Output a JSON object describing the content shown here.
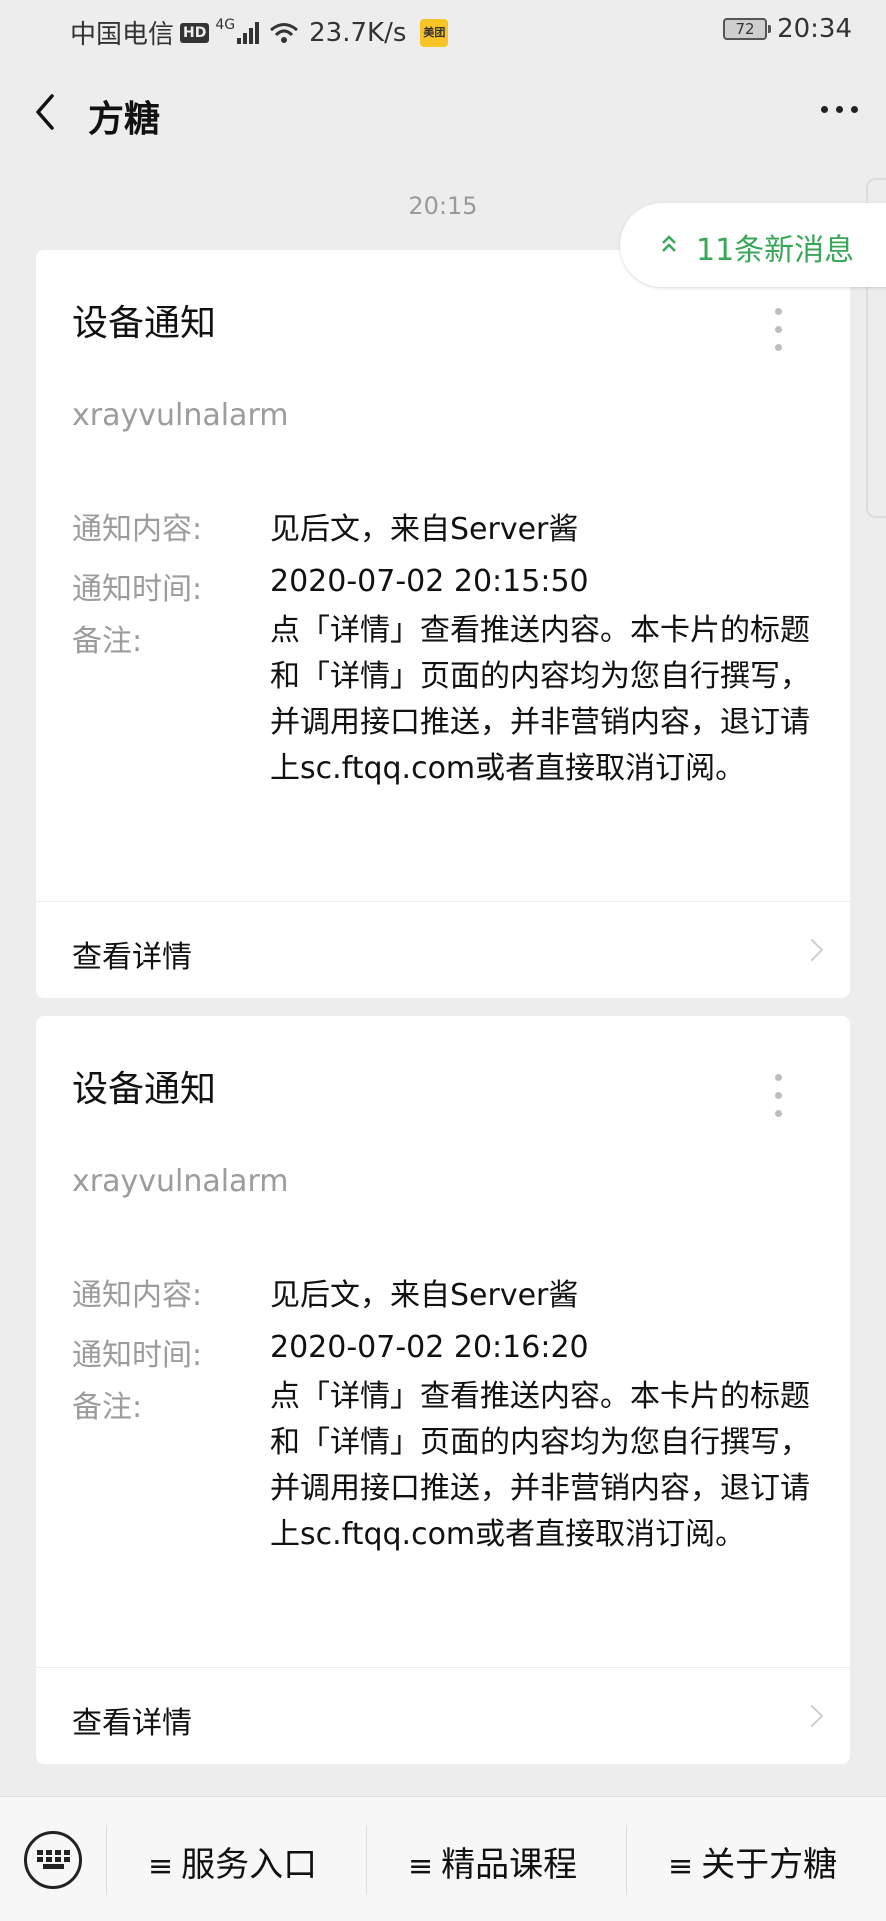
{
  "status_bar": {
    "carrier": "中国电信",
    "hd": "HD",
    "network": "4G",
    "speed": "23.7K/s",
    "app_badge": "美团",
    "battery": "72",
    "time": "20:34"
  },
  "navbar": {
    "title": "方糖"
  },
  "timestamp": "20:15",
  "new_messages": "11条新消息",
  "cards": [
    {
      "title": "设备通知",
      "subtitle": "xrayvulnalarm",
      "content_label": "通知内容:",
      "content_value": "见后文，来自Server酱",
      "time_label": "通知时间:",
      "time_value": "2020-07-02 20:15:50",
      "note_label": "备注:",
      "note_value": "点「详情」查看推送内容。本卡片的标题和「详情」页面的内容均为您自行撰写，并调用接口推送，并非营销内容，退订请上sc.ftqq.com或者直接取消订阅。",
      "detail_label": "查看详情"
    },
    {
      "title": "设备通知",
      "subtitle": "xrayvulnalarm",
      "content_label": "通知内容:",
      "content_value": "见后文，来自Server酱",
      "time_label": "通知时间:",
      "time_value": "2020-07-02 20:16:20",
      "note_label": "备注:",
      "note_value": "点「详情」查看推送内容。本卡片的标题和「详情」页面的内容均为您自行撰写，并调用接口推送，并非营销内容，退订请上sc.ftqq.com或者直接取消订阅。",
      "detail_label": "查看详情"
    }
  ],
  "bottom_menu": {
    "items": [
      {
        "label": "服务入口"
      },
      {
        "label": "精品课程"
      },
      {
        "label": "关于方糖"
      }
    ],
    "menu_glyph": "≡"
  },
  "colors": {
    "background": "#ededed",
    "card": "#ffffff",
    "accent_green": "#3aa657",
    "muted_text": "#9c9c9c"
  },
  "icons": {
    "back": "chevron-left-icon",
    "more": "more-horizontal-icon",
    "card_menu": "more-vertical-icon",
    "new_messages": "double-chevron-up-icon",
    "keyboard": "keyboard-icon",
    "detail": "chevron-right-icon"
  }
}
